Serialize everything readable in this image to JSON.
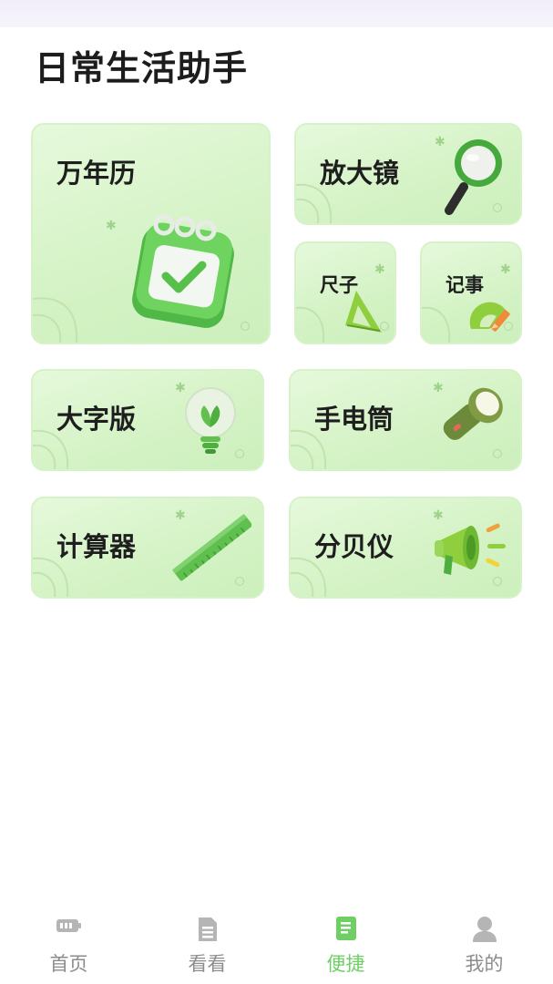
{
  "page": {
    "title": "日常生活助手"
  },
  "tools": {
    "calendar": {
      "label": "万年历"
    },
    "magnifier": {
      "label": "放大镜"
    },
    "ruler": {
      "label": "尺子"
    },
    "notes": {
      "label": "记事"
    },
    "large_font": {
      "label": "大字版"
    },
    "flashlight": {
      "label": "手电筒"
    },
    "calculator": {
      "label": "计算器"
    },
    "decibel": {
      "label": "分贝仪"
    }
  },
  "tabbar": {
    "items": [
      {
        "label": "首页",
        "icon": "battery-icon",
        "active": false
      },
      {
        "label": "看看",
        "icon": "document-icon",
        "active": false
      },
      {
        "label": "便捷",
        "icon": "notepad-icon",
        "active": true
      },
      {
        "label": "我的",
        "icon": "user-icon",
        "active": false
      }
    ]
  },
  "colors": {
    "card_bg": "#d9f4cc",
    "card_border": "#d6f2c8",
    "accent": "#6fcf64",
    "tab_inactive": "#8c8c8c",
    "title": "#1c1c1c"
  }
}
